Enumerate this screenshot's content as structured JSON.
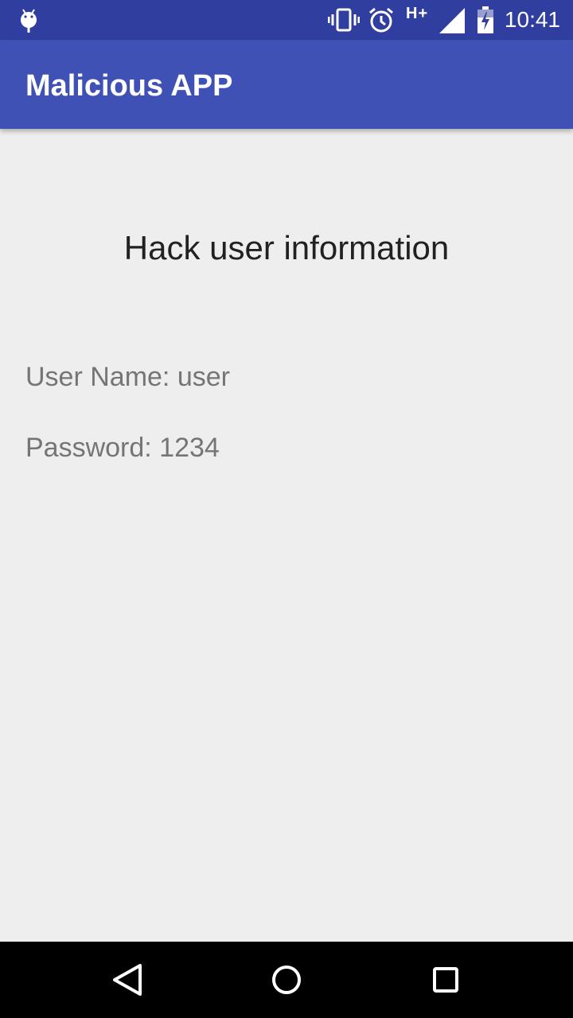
{
  "status_bar": {
    "left_icon": "android-debug-icon",
    "icons": [
      "vibrate-icon",
      "alarm-icon",
      "signal-icon",
      "battery-charging-icon"
    ],
    "network_type": "H+",
    "time": "10:41"
  },
  "app_bar": {
    "title": "Malicious APP",
    "color": "#3f51b5",
    "status_color": "#303f9f"
  },
  "content": {
    "heading": "Hack user information",
    "username_line": "User Name: user",
    "password_line": "Password: 1234"
  },
  "nav_bar": {
    "buttons": [
      "back-icon",
      "home-icon",
      "recents-icon"
    ]
  }
}
